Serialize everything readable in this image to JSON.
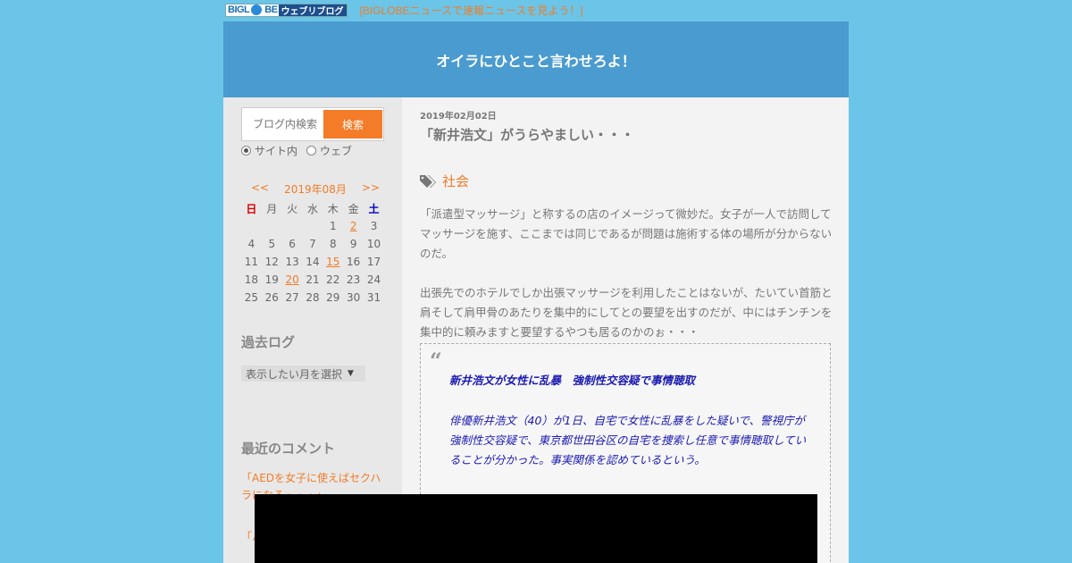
{
  "topbar": {
    "logo_big": "BIGL",
    "logo_be": "BE",
    "logo_blog": "ウェブリブログ",
    "news_link": "[BIGLOBEニュースで速報ニュースを見よう！]"
  },
  "header": {
    "title": "オイラにひとこと言わせろよ！"
  },
  "sidebar": {
    "search": {
      "placeholder": "ブログ内検索",
      "button": "検索"
    },
    "radios": [
      {
        "label": "サイト内",
        "checked": true
      },
      {
        "label": "ウェブ",
        "checked": false
      }
    ],
    "calendar": {
      "prev": "<<",
      "month": "2019年08月",
      "next": ">>",
      "weekdays": [
        "日",
        "月",
        "火",
        "水",
        "木",
        "金",
        "土"
      ],
      "weeks": [
        [
          "",
          "",
          "",
          "",
          "1",
          "2",
          "3"
        ],
        [
          "4",
          "5",
          "6",
          "7",
          "8",
          "9",
          "10"
        ],
        [
          "11",
          "12",
          "13",
          "14",
          "15",
          "16",
          "17"
        ],
        [
          "18",
          "19",
          "20",
          "21",
          "22",
          "23",
          "24"
        ],
        [
          "25",
          "26",
          "27",
          "28",
          "29",
          "30",
          "31"
        ]
      ],
      "linked_days": [
        "2",
        "15",
        "20"
      ]
    },
    "archive": {
      "heading": "過去ログ",
      "select": "表示したい月を選択"
    },
    "comments": {
      "heading": "最近のコメント",
      "items": [
        "「AEDを女子に使えばセクハラになる・・・」",
        "「ハ"
      ]
    }
  },
  "post": {
    "date": "2019年02月02日",
    "title": "「新井浩文」がうらやましい・・・",
    "tag": "社会",
    "para1": "「派遣型マッサージ」と称するの店のイメージって微妙だ。女子が一人で訪問してマッサージを施す、ここまでは同じであるが問題は施術する体の場所が分からないのだ。",
    "para2": "出張先でのホテルでしか出張マッサージを利用したことはないが、たいてい首筋と肩そして肩甲骨のあたりを集中的にしてとの要望を出すのだが、中にはチンチンを集中的に頼みますと要望するやつも居るのかのぉ・・・",
    "quote": {
      "title": "新井浩文が女性に乱暴　強制性交容疑で事情聴取",
      "body": "俳優新井浩文（40）が1日、自宅で女性に乱暴をした疑いで、警視庁が強制性交容疑で、東京都世田谷区の自宅を捜索し任意で事情聴取していることが分かった。事実関係を認めているという。"
    }
  }
}
